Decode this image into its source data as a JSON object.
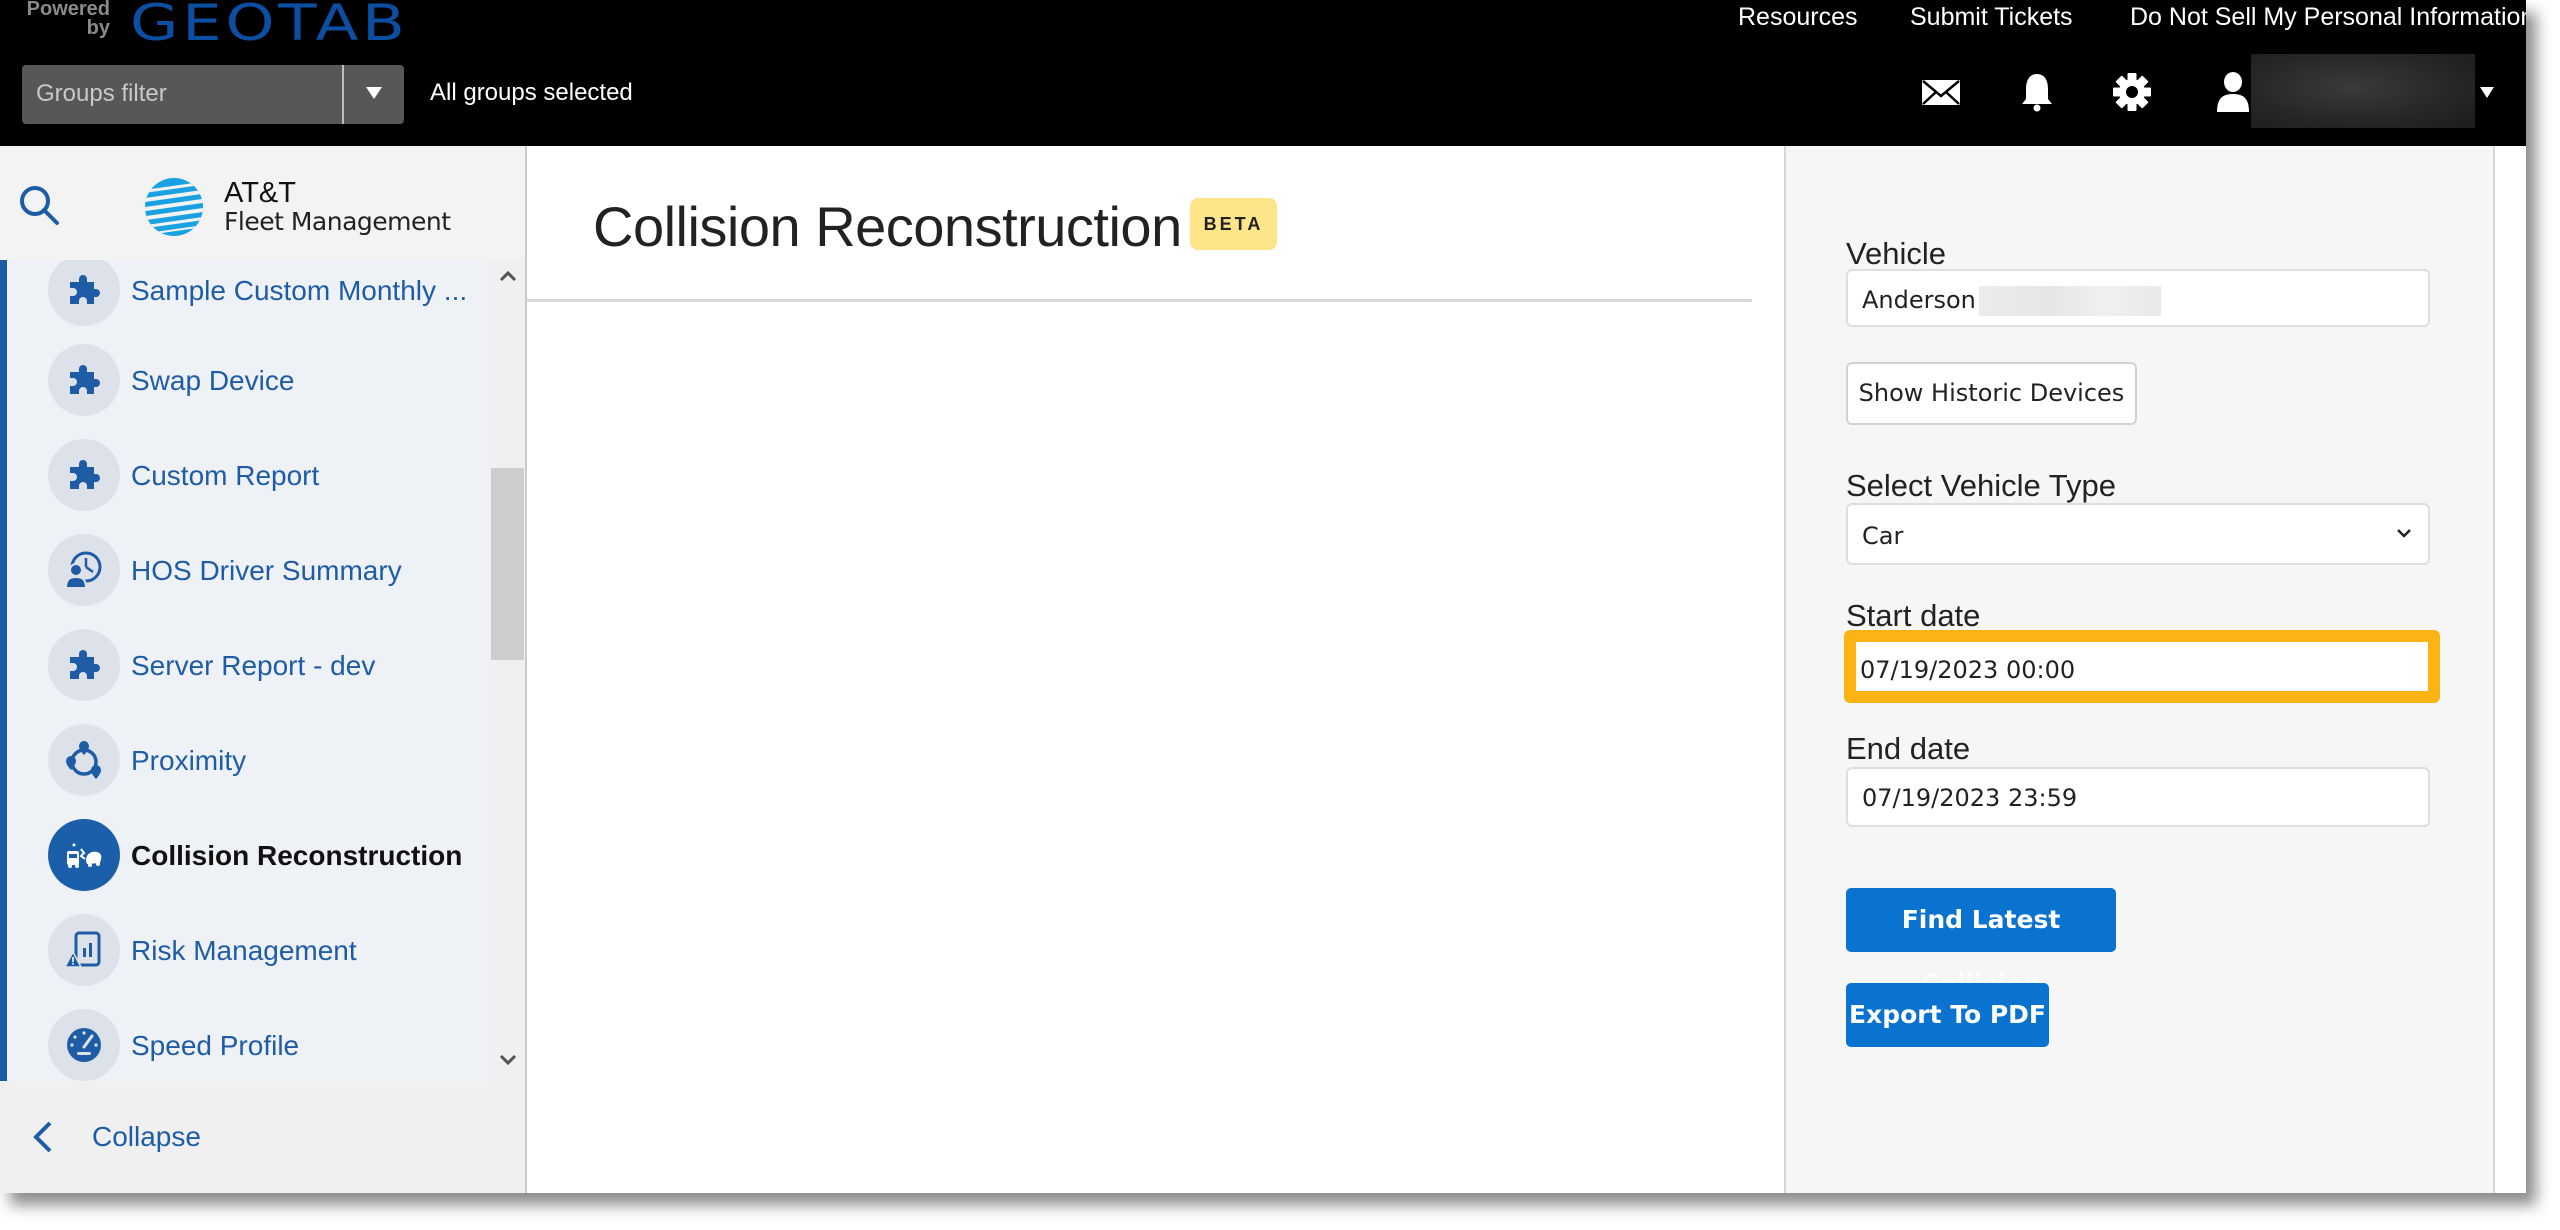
{
  "header": {
    "powered_by": "Powered by",
    "brand": "GEOTAB",
    "links": [
      "Resources",
      "Submit Tickets",
      "Do Not Sell My Personal Information"
    ],
    "groups_filter": {
      "placeholder": "Groups filter",
      "status": "All groups selected"
    },
    "icons": [
      "mail-icon",
      "bell-icon",
      "gear-icon",
      "user-icon"
    ],
    "username": ""
  },
  "sidebar": {
    "brand_line1": "AT&T",
    "brand_line2": "Fleet Management",
    "items": [
      {
        "label": "Sample Custom Monthly ...",
        "icon": "puzzle-icon",
        "active": false
      },
      {
        "label": "Swap Device",
        "icon": "puzzle-icon",
        "active": false
      },
      {
        "label": "Custom Report",
        "icon": "puzzle-icon",
        "active": false
      },
      {
        "label": "HOS Driver Summary",
        "icon": "driver-clock-icon",
        "active": false
      },
      {
        "label": "Server Report - dev",
        "icon": "puzzle-icon",
        "active": false
      },
      {
        "label": "Proximity",
        "icon": "proximity-icon",
        "active": false
      },
      {
        "label": "Collision Reconstruction",
        "icon": "collision-icon",
        "active": true
      },
      {
        "label": "Risk Management",
        "icon": "risk-icon",
        "active": false
      },
      {
        "label": "Speed Profile",
        "icon": "speedometer-icon",
        "active": false
      }
    ],
    "collapse_label": "Collapse"
  },
  "main": {
    "title": "Collision Reconstruction",
    "badge": "BETA"
  },
  "panel": {
    "vehicle_label": "Vehicle",
    "vehicle_value": "Anderson",
    "show_historic_label": "Show Historic Devices",
    "vehicle_type_label": "Select Vehicle Type",
    "vehicle_type_value": "Car",
    "start_date_label": "Start date",
    "start_date_value": "07/19/2023 00:00",
    "end_date_label": "End date",
    "end_date_value": "07/19/2023 23:59",
    "find_button": "Find Latest Collision",
    "export_button": "Export To PDF"
  },
  "colors": {
    "highlight": "#fbb414",
    "primary_button": "#0a73d0",
    "nav_text": "#1f5ca6",
    "beta_badge": "#fde68a"
  }
}
